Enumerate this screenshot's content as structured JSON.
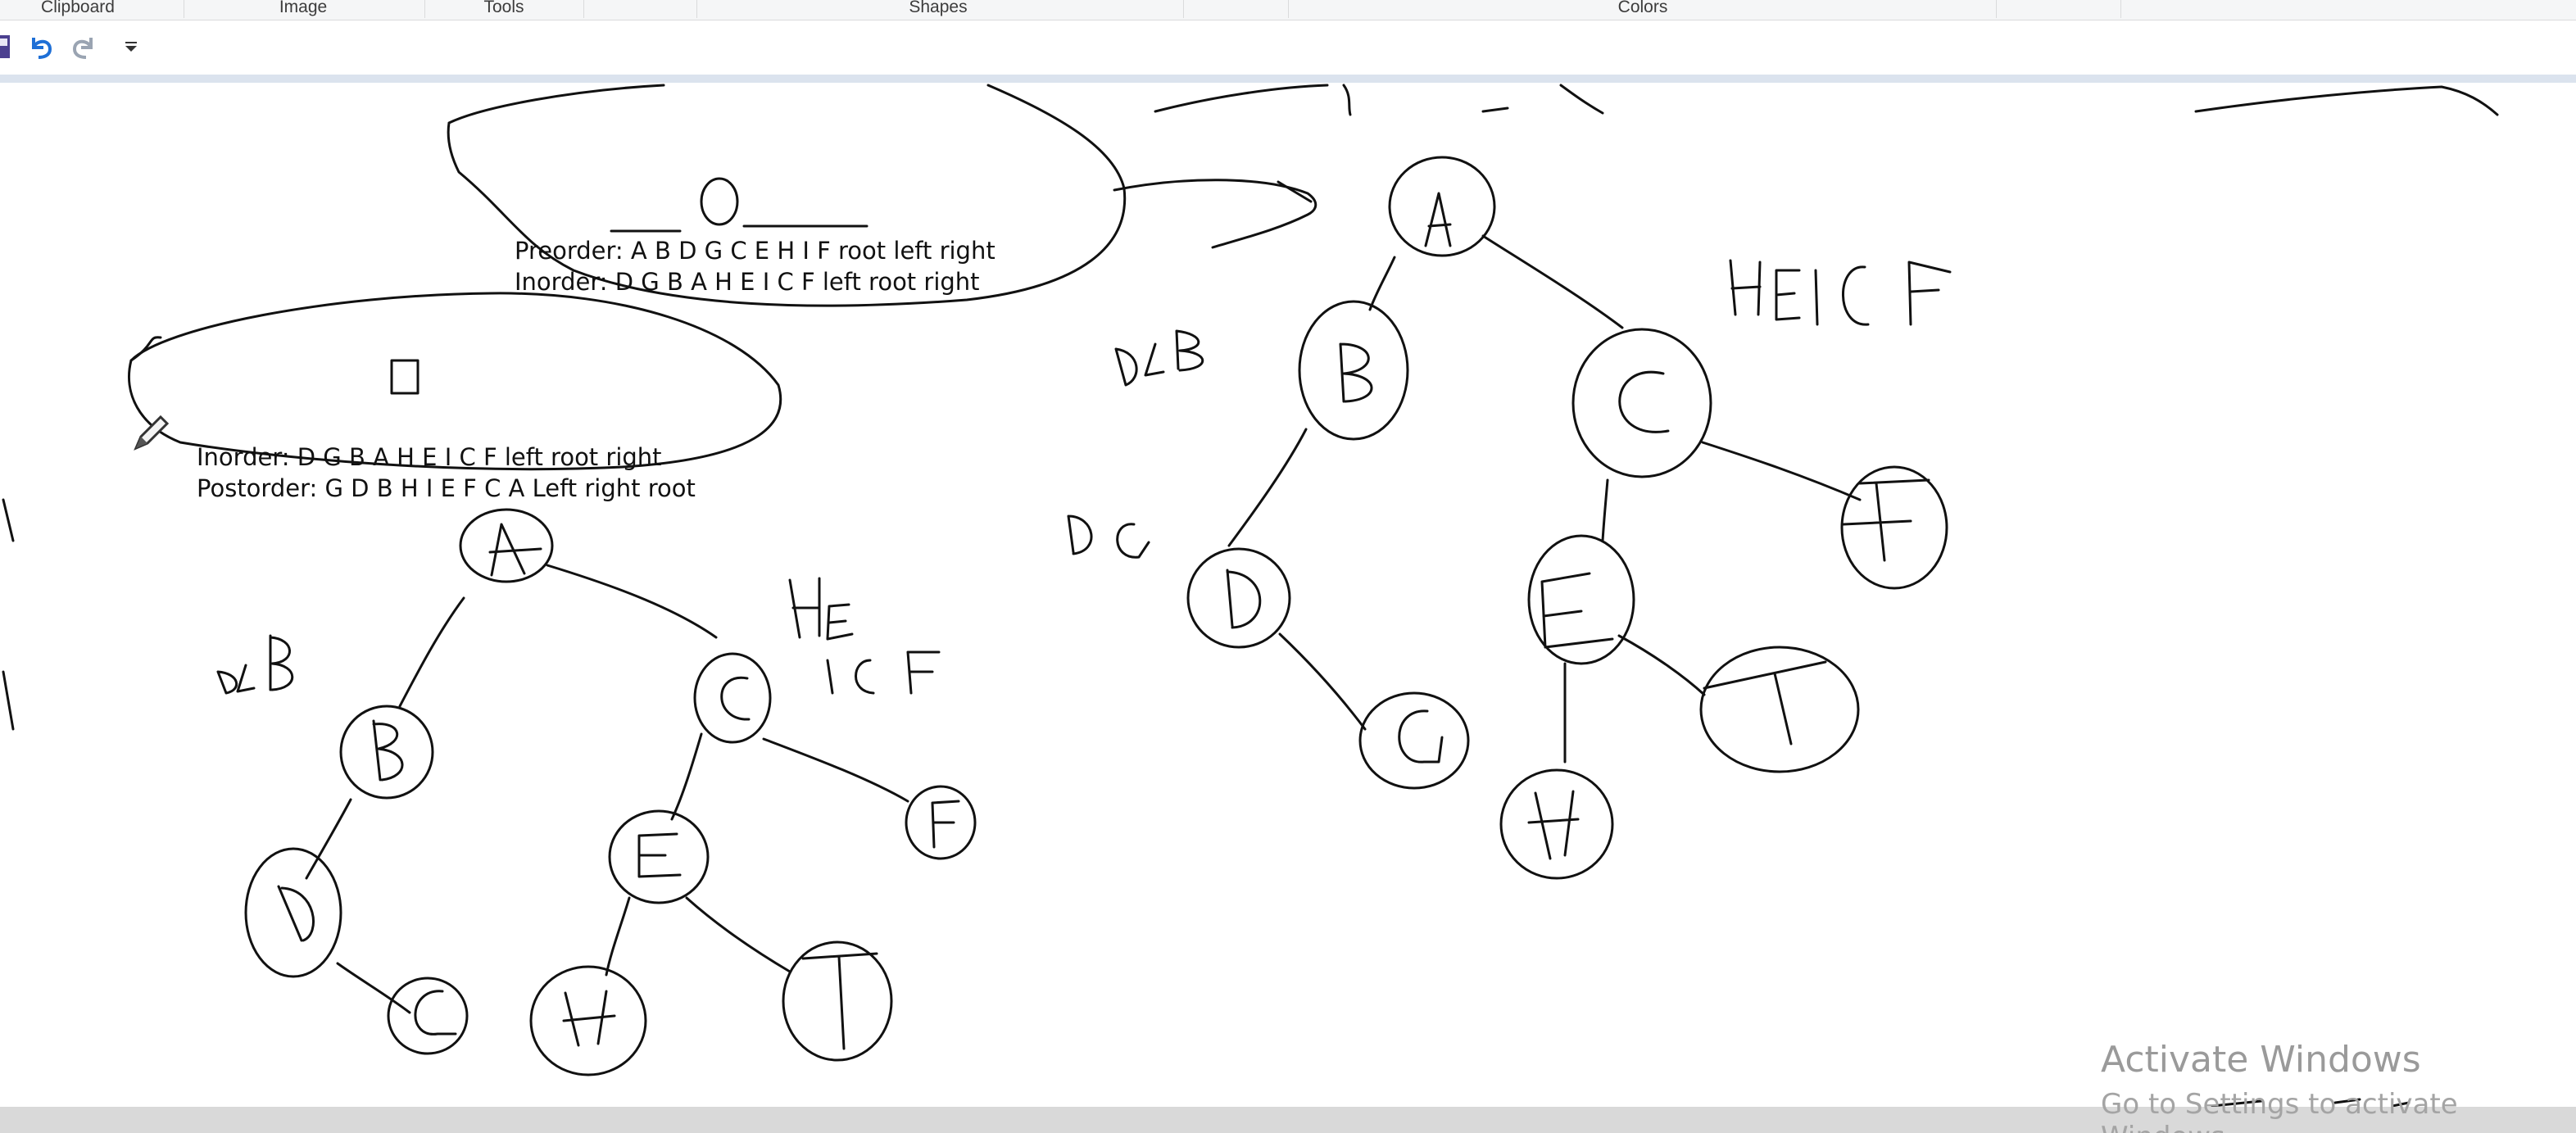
{
  "ribbon": {
    "groups": [
      "Clipboard",
      "Image",
      "Tools",
      "Shapes",
      "Colors"
    ]
  },
  "quick_access": {
    "icons": [
      "save-icon",
      "undo-icon",
      "redo-icon",
      "customize-dropdown-icon"
    ],
    "colors": {
      "undo": "#1e6fd6",
      "redo": "#9aa4b2",
      "save": "#4b3f8f"
    }
  },
  "notes": {
    "top": {
      "line1": "Preorder: A B D G C E H I F root left right",
      "line2": "Inorder: D G B A H E I C F left root right"
    },
    "left": {
      "line1": "Inorder: D G B A H E I C F left root right",
      "line2": "Postorder: G D B H I E F C A Left right root"
    }
  },
  "handwriting": {
    "left_tree_nodes": [
      "A",
      "B",
      "C",
      "D",
      "G",
      "E",
      "F",
      "H",
      "I"
    ],
    "left_tree_labels": [
      "DGB",
      "HE",
      "ICF"
    ],
    "right_tree_nodes": [
      "A",
      "B",
      "C",
      "D",
      "G",
      "E",
      "F",
      "H",
      "I"
    ],
    "right_tree_labels": [
      "DGB",
      "HEICF",
      "DG"
    ]
  },
  "watermark": {
    "title": "Activate Windows",
    "subtitle": "Go to Settings to activate Windows"
  }
}
